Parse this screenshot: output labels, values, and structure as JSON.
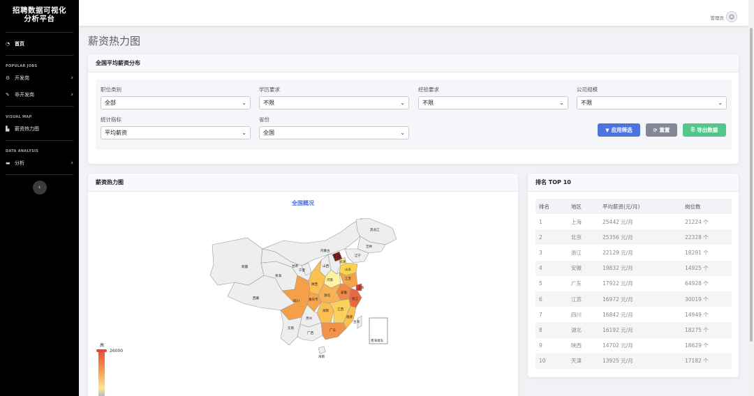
{
  "sidebar": {
    "brand_line1": "招聘数据可视化",
    "brand_line2": "分析平台",
    "home": {
      "label": "首页",
      "icon": "dashboard-icon"
    },
    "section_popular": "POPULAR JOBS",
    "dev_jobs": {
      "label": "开发岗",
      "icon": "gear-icon"
    },
    "non_dev_jobs": {
      "label": "非开发岗",
      "icon": "wrench-icon"
    },
    "section_visual": "VISUAL MAP",
    "salary_heatmap": {
      "label": "薪资热力图",
      "icon": "factory-icon"
    },
    "section_analysis": "DATA ANALYSIS",
    "analysis": {
      "label": "分析",
      "icon": "folder-icon"
    }
  },
  "topbar": {
    "user_name": "管理员"
  },
  "page_title": "薪资热力图",
  "filter_card": {
    "title": "全国平均薪资分布",
    "job_category": {
      "label": "职位类别",
      "value": "全部"
    },
    "education": {
      "label": "学历要求",
      "value": "不限"
    },
    "experience": {
      "label": "经验要求",
      "value": "不限"
    },
    "company_size": {
      "label": "公司规模",
      "value": "不限"
    },
    "metric": {
      "label": "统计指标",
      "value": "平均薪资"
    },
    "province": {
      "label": "省份",
      "value": "全国"
    },
    "apply_label": "应用筛选",
    "reset_label": "重置",
    "export_label": "导出数据"
  },
  "map_card": {
    "title": "薪资热力图",
    "subtitle": "全国概况",
    "legend_high": "高",
    "legend_max": "26000",
    "colors": {
      "low": "#5b8ff9",
      "mid": "#fde68a",
      "high": "#e8473b",
      "none": "#eeeeee"
    },
    "provinces": [
      {
        "name": "新疆",
        "value": null
      },
      {
        "name": "西藏",
        "value": null
      },
      {
        "name": "青海",
        "value": null
      },
      {
        "name": "甘肃",
        "value": null
      },
      {
        "name": "内蒙古",
        "value": null
      },
      {
        "name": "黑龙江",
        "value": null
      },
      {
        "name": "吉林",
        "value": null
      },
      {
        "name": "辽宁",
        "value": null
      },
      {
        "name": "宁夏",
        "value": null
      },
      {
        "name": "山西",
        "value": null
      },
      {
        "name": "天津",
        "value": 13925
      },
      {
        "name": "北京",
        "value": 25356
      },
      {
        "name": "山东",
        "value": null
      },
      {
        "name": "河南",
        "value": null
      },
      {
        "name": "陕西",
        "value": 14702
      },
      {
        "name": "江苏",
        "value": 16972
      },
      {
        "name": "上海",
        "value": 25442
      },
      {
        "name": "安徽",
        "value": 19832
      },
      {
        "name": "湖北",
        "value": 16192
      },
      {
        "name": "四川",
        "value": 16842
      },
      {
        "name": "重庆市",
        "value": null
      },
      {
        "name": "浙江",
        "value": 22129
      },
      {
        "name": "湖南",
        "value": null
      },
      {
        "name": "江西",
        "value": null
      },
      {
        "name": "贵州",
        "value": null
      },
      {
        "name": "福建",
        "value": null
      },
      {
        "name": "云南",
        "value": null
      },
      {
        "name": "广西",
        "value": null
      },
      {
        "name": "广东",
        "value": 17922
      },
      {
        "name": "台湾",
        "value": null
      },
      {
        "name": "海南",
        "value": null
      }
    ],
    "inset_label": "南海诸岛"
  },
  "rank_card": {
    "title": "排名 TOP 10",
    "headers": [
      "排名",
      "地区",
      "平均薪资(元/月)",
      "岗位数"
    ],
    "rows": [
      [
        "1",
        "上海",
        "25442 元/月",
        "21224 个"
      ],
      [
        "2",
        "北京",
        "25356 元/月",
        "22328 个"
      ],
      [
        "3",
        "浙江",
        "22129 元/月",
        "18291 个"
      ],
      [
        "4",
        "安徽",
        "19832 元/月",
        "14925 个"
      ],
      [
        "5",
        "广东",
        "17922 元/月",
        "64928 个"
      ],
      [
        "6",
        "江苏",
        "16972 元/月",
        "30019 个"
      ],
      [
        "7",
        "四川",
        "16842 元/月",
        "14949 个"
      ],
      [
        "8",
        "湖北",
        "16192 元/月",
        "18275 个"
      ],
      [
        "9",
        "陕西",
        "14702 元/月",
        "18629 个"
      ],
      [
        "10",
        "天津",
        "13925 元/月",
        "17182 个"
      ]
    ]
  }
}
